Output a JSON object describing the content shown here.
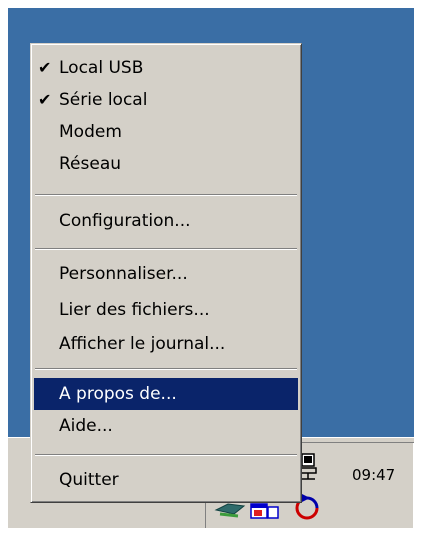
{
  "menu": {
    "items": [
      {
        "label": "Local USB",
        "checked": true
      },
      {
        "label": "Série local",
        "checked": true
      },
      {
        "label": "Modem",
        "checked": false
      },
      {
        "label": "Réseau",
        "checked": false
      },
      {
        "label": "Configuration...",
        "checked": false
      },
      {
        "label": "Personnaliser...",
        "checked": false
      },
      {
        "label": "Lier des fichiers...",
        "checked": false
      },
      {
        "label": "Afficher le journal...",
        "checked": false
      },
      {
        "label": "A propos de...",
        "checked": false,
        "selected": true
      },
      {
        "label": "Aide...",
        "checked": false
      },
      {
        "label": "Quitter",
        "checked": false
      }
    ],
    "check_glyph": "✔"
  },
  "tray": {
    "clock": "09:47",
    "icons": [
      "network-computer-icon",
      "sync-icon",
      "window-icon",
      "refresh-icon"
    ]
  },
  "colors": {
    "desktop": "#3a6ea5",
    "menu_bg": "#d4d0c8",
    "highlight": "#0a246a"
  }
}
